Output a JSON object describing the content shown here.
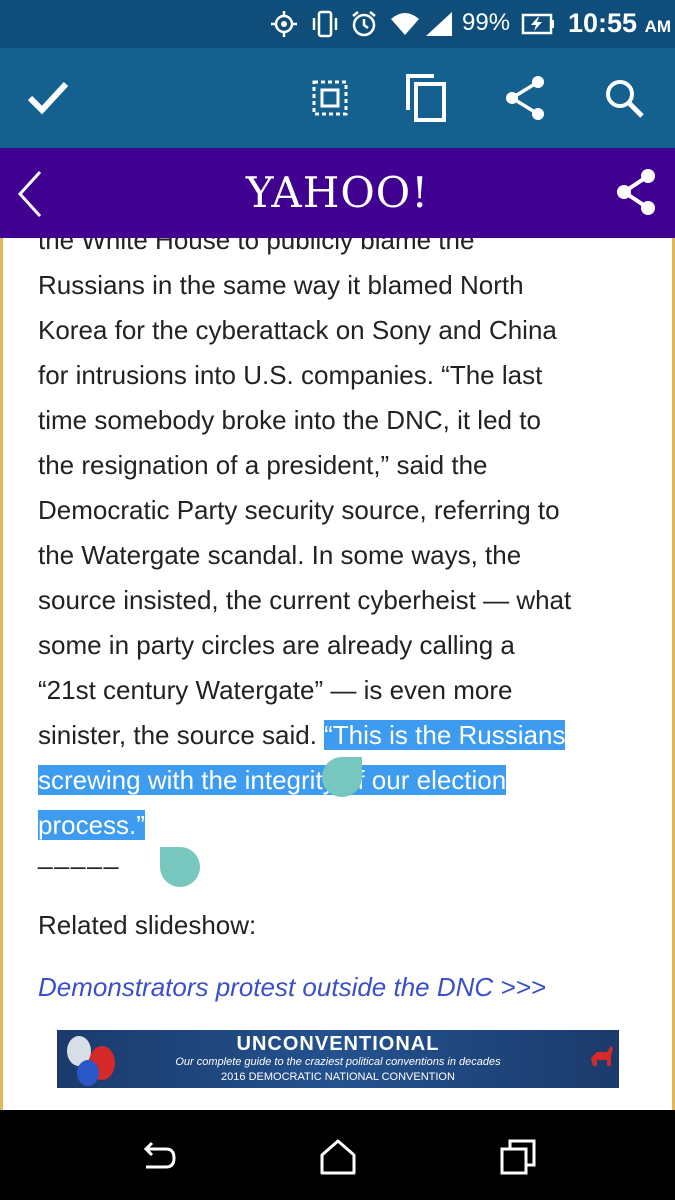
{
  "status_bar": {
    "icons": [
      "crosshair-icon",
      "vibrate-icon",
      "alarm-icon",
      "wifi-icon",
      "signal-icon",
      "battery-charging-icon"
    ],
    "battery_percent": "99%",
    "time": "10:55",
    "ampm": "AM"
  },
  "action_bar": {
    "buttons": [
      "done-check-icon",
      "select-all-icon",
      "copy-icon",
      "share-icon",
      "search-icon"
    ]
  },
  "yahoo_header": {
    "logo": "YAHOO!",
    "icons": [
      "back-chevron-icon",
      "share-icon"
    ],
    "brand_color": "#400090"
  },
  "article": {
    "lines": [
      "the White House to publicly blame the",
      "Russians in the same way it blamed North",
      "Korea for the cyberattack on Sony and China",
      "for intrusions into U.S. companies. “The last",
      "time somebody broke into the DNC, it led to",
      "the resignation of a president,” said the",
      "Democratic Party security source, referring to",
      "the Watergate scandal. In some ways, the",
      "source insisted, the current cyberheist — what",
      "some in party circles are already calling a",
      "“21st century Watergate” — is even more"
    ],
    "line12_plain": "sinister, the source said. ",
    "line12_selected": "“This is the Russians",
    "line13_selected": "screwing with the integrity of our election",
    "line14_selected": "process.”",
    "divider": "_____",
    "related_label": "Related slideshow:",
    "related_link": "Demonstrators protest outside the DNC >>>",
    "selection_color": "#3d9bf0",
    "link_color": "#3b4fc8"
  },
  "banner": {
    "title": "UNCONVENTIONAL",
    "subtitle": "Our complete guide to the craziest political conventions in decades",
    "footer": "2016 DEMOCRATIC NATIONAL CONVENTION"
  },
  "nav_bar": {
    "icons": [
      "back-nav-icon",
      "home-icon",
      "recent-apps-icon"
    ]
  }
}
